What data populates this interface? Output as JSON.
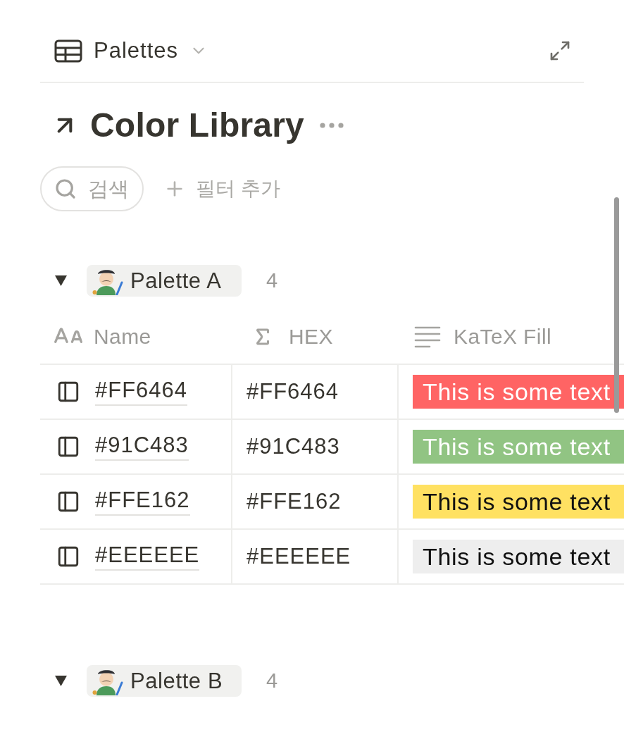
{
  "view": {
    "title": "Palettes"
  },
  "database": {
    "title": "Color Library"
  },
  "toolbar": {
    "search": {
      "placeholder": "검색"
    },
    "add_filter": "필터 추가"
  },
  "groups": [
    {
      "name": "Palette A",
      "count": "4",
      "expanded": true,
      "columns": [
        {
          "kind": "title",
          "label": "Name"
        },
        {
          "kind": "formula",
          "label": "HEX"
        },
        {
          "kind": "text",
          "label": "KaTeX Fill"
        }
      ],
      "rows": [
        {
          "name": "#FF6464",
          "hex": "#FF6464",
          "fill": "This is some text",
          "color": "#ff6464"
        },
        {
          "name": "#91C483",
          "hex": "#91C483",
          "fill": "This is some text",
          "color": "#91c483"
        },
        {
          "name": "#FFE162",
          "hex": "#FFE162",
          "fill": "This is some text",
          "color": "#ffe162"
        },
        {
          "name": "#EEEEEE",
          "hex": "#EEEEEE",
          "fill": "This is some text",
          "color": "#eeeeee"
        }
      ]
    },
    {
      "name": "Palette B",
      "count": "4",
      "expanded": true
    }
  ]
}
